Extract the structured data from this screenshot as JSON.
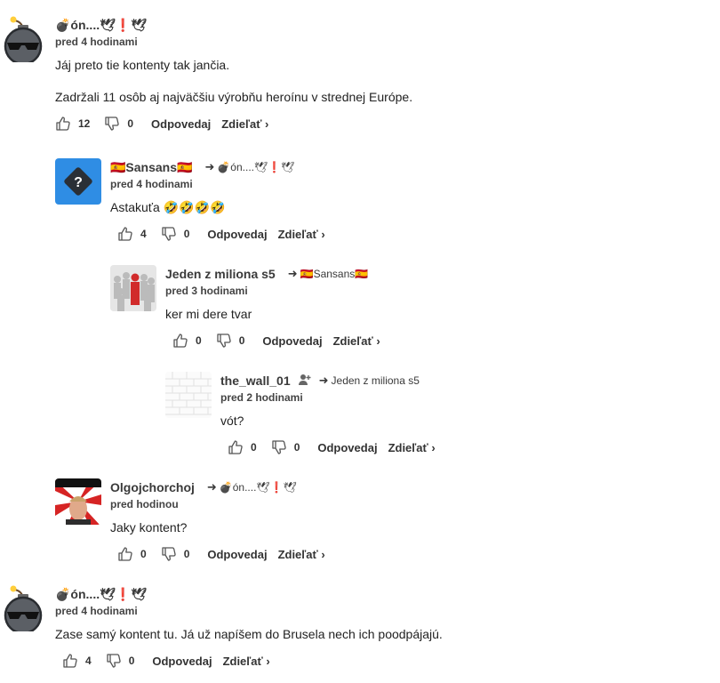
{
  "ui": {
    "reply_label": "Odpovedaj",
    "share_label": "Zdieľať ›",
    "reply_arrow": "➜"
  },
  "comments": [
    {
      "username": "💣ón....🕊❗🕊",
      "time": "pred 4 hodinami",
      "paragraphs": [
        "Jáj preto tie kontenty tak jančia.",
        "Zadržali 11 osôb aj najväčšiu výrobňu heroínu v strednej Európe."
      ],
      "likes": "12",
      "dislikes": "0"
    },
    {
      "username": "🇪🇸Sansans🇪🇸",
      "reply_to": "💣ón....🕊❗🕊",
      "time": "pred 4 hodinami",
      "paragraphs": [
        "Astakuťa 🤣🤣🤣🤣"
      ],
      "likes": "4",
      "dislikes": "0"
    },
    {
      "username": "Jeden z miliona s5",
      "reply_to": "🇪🇸Sansans🇪🇸",
      "time": "pred 3 hodinami",
      "paragraphs": [
        "ker mi dere tvar"
      ],
      "likes": "0",
      "dislikes": "0"
    },
    {
      "username": "the_wall_01",
      "reply_to": "Jeden z miliona s5",
      "time": "pred 2 hodinami",
      "paragraphs": [
        "vót?"
      ],
      "likes": "0",
      "dislikes": "0"
    },
    {
      "username": "Olgojchorchoj",
      "reply_to": "💣ón....🕊❗🕊",
      "time": "pred hodinou",
      "paragraphs": [
        "Jaky kontent?"
      ],
      "likes": "0",
      "dislikes": "0"
    },
    {
      "username": "💣ón....🕊❗🕊",
      "time": "pred 4 hodinami",
      "paragraphs": [
        "Zase samý kontent tu. Já už napíšem do Brusela nech ich poodpájajú."
      ],
      "likes": "4",
      "dislikes": "0"
    }
  ]
}
